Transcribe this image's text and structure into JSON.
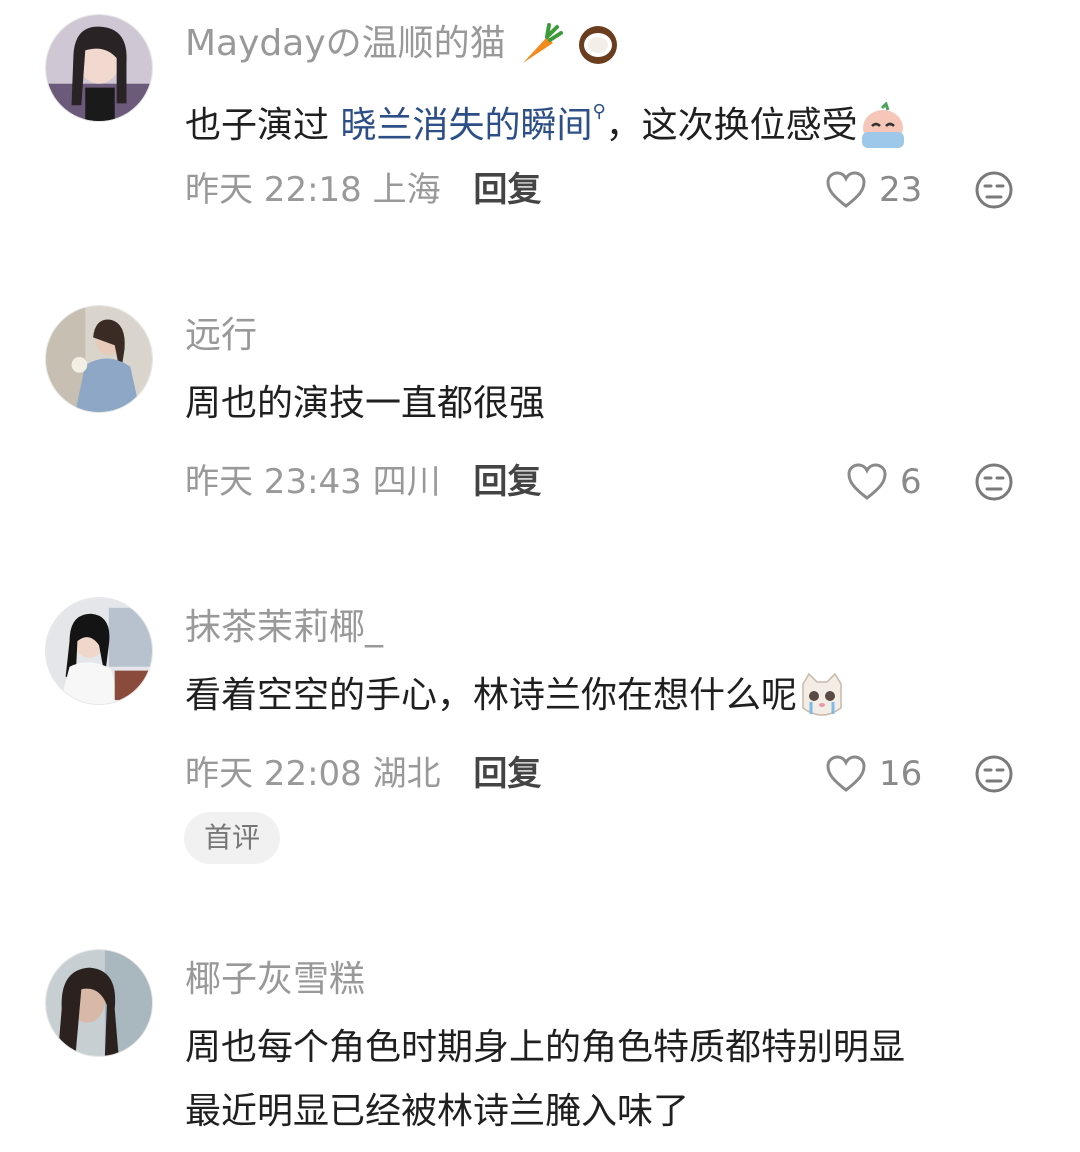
{
  "comments": [
    {
      "username": "Maydayの温顺的猫",
      "text_before": "也子演过 ",
      "link_text": "晓兰消失的瞬间",
      "text_after": "，这次换位感受",
      "time": "昨天 22:18",
      "location": "上海",
      "reply_label": "回复",
      "likes": "23"
    },
    {
      "username": "远行",
      "text": "周也的演技一直都很强",
      "time": "昨天 23:43",
      "location": "四川",
      "reply_label": "回复",
      "likes": "6"
    },
    {
      "username": "抹茶茉莉椰_",
      "text": "看着空空的手心，林诗兰你在想什么呢",
      "time": "昨天 22:08",
      "location": "湖北",
      "reply_label": "回复",
      "likes": "16",
      "badge": "首评"
    },
    {
      "username": "椰子灰雪糕",
      "text_line1": "周也每个角色时期身上的角色特质都特别明显",
      "text_line2": "最近明显已经被林诗兰腌入味了"
    }
  ],
  "icons": {
    "like": "heart-outline-icon",
    "dislike": "meh-face-icon",
    "username_emojis": [
      "carrot-emoji",
      "coconut-emoji"
    ],
    "comment1_emoji": "crying-face-emoji",
    "comment3_emoji": "crying-cat-emoji"
  },
  "colors": {
    "username": "#999999",
    "text": "#1f1f1f",
    "link": "#2d4f87",
    "meta": "#999999",
    "badge_bg": "#f1f1f1"
  }
}
